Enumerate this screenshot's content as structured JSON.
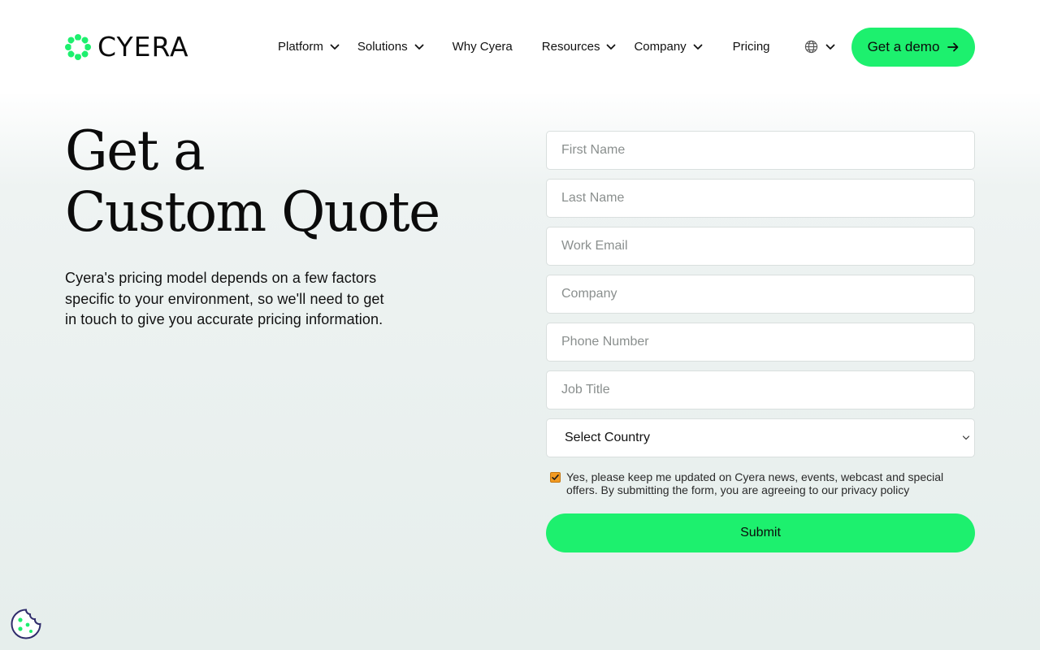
{
  "brand": {
    "name": "CYERA",
    "accent": "#1df06e"
  },
  "nav": {
    "items": [
      {
        "label": "Platform",
        "has_dropdown": true
      },
      {
        "label": "Solutions",
        "has_dropdown": true
      },
      {
        "label": "Why Cyera",
        "has_dropdown": false
      },
      {
        "label": "Resources",
        "has_dropdown": true
      },
      {
        "label": "Company",
        "has_dropdown": true
      },
      {
        "label": "Pricing",
        "has_dropdown": false
      }
    ],
    "language_icon": "globe-icon",
    "cta_label": "Get a demo"
  },
  "hero": {
    "title_line1": "Get a",
    "title_line2": "Custom Quote",
    "intro": "Cyera's pricing model depends on a few factors specific to your environment, so we'll need to get in touch to give you accurate pricing information."
  },
  "form": {
    "fields": [
      {
        "placeholder": "First Name",
        "value": ""
      },
      {
        "placeholder": "Last Name",
        "value": ""
      },
      {
        "placeholder": "Work Email",
        "value": ""
      },
      {
        "placeholder": "Company",
        "value": ""
      },
      {
        "placeholder": "Phone Number",
        "value": ""
      },
      {
        "placeholder": "Job Title",
        "value": ""
      }
    ],
    "country_select": {
      "selected": "Select Country"
    },
    "consent": {
      "checked": true,
      "text": "Yes, please keep me updated on Cyera news, events, webcast and special offers. By submitting the form, you are agreeing to our privacy policy"
    },
    "submit_label": "Submit"
  },
  "cookie": {
    "icon": "cookie-icon"
  }
}
